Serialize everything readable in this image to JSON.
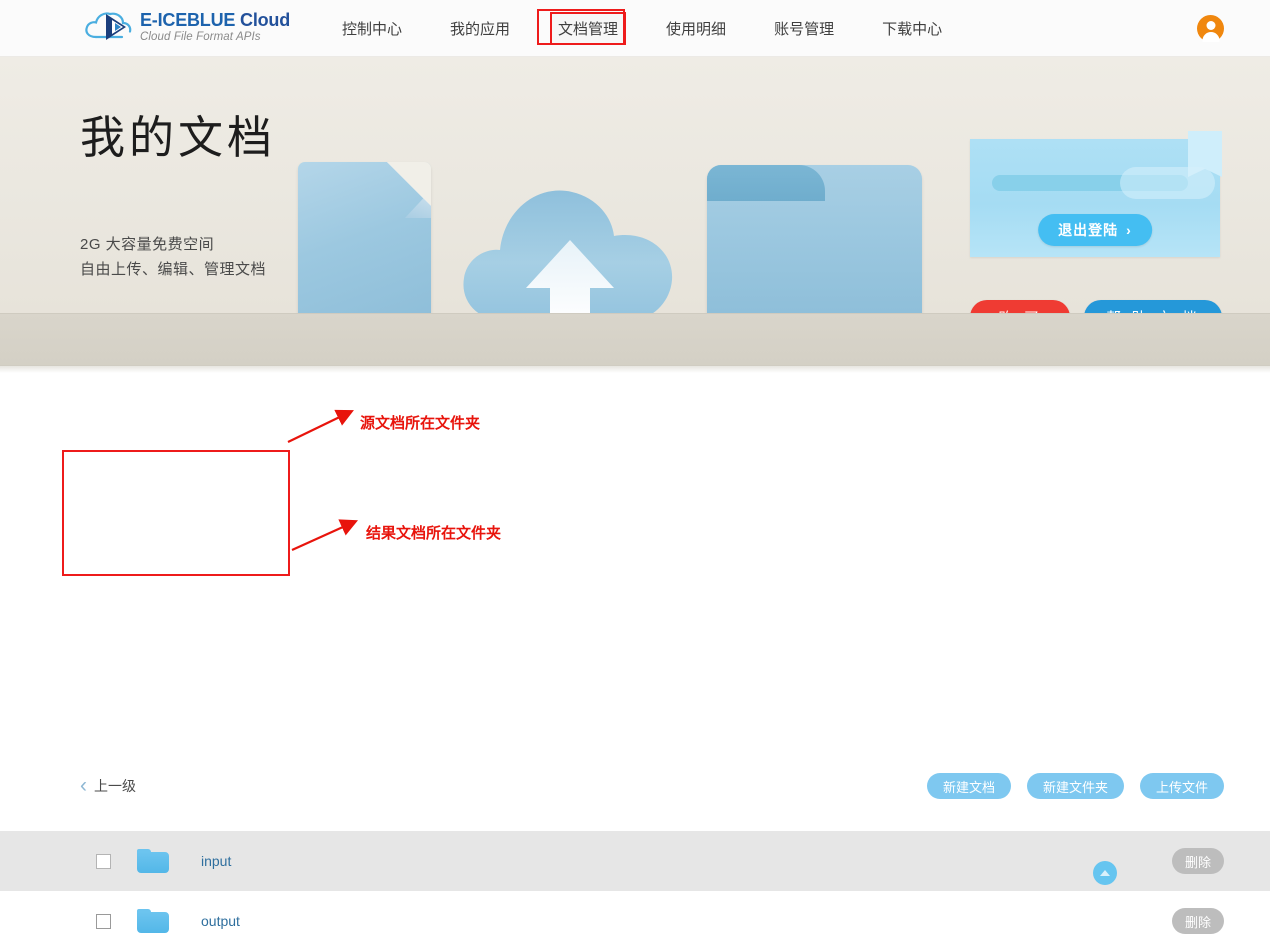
{
  "header": {
    "logo": {
      "icon": "cloud-logo-icon",
      "title_part1": "E-ICEBLUE",
      "title_part2": "Cloud",
      "subtitle": "Cloud File Format APIs"
    },
    "nav": [
      {
        "label": "控制中心",
        "name": "nav-control-center",
        "marked": false
      },
      {
        "label": "我的应用",
        "name": "nav-my-apps",
        "marked": false
      },
      {
        "label": "文档管理",
        "name": "nav-document-management",
        "marked": true
      },
      {
        "label": "使用明细",
        "name": "nav-usage-details",
        "marked": false
      },
      {
        "label": "账号管理",
        "name": "nav-account-management",
        "marked": false
      },
      {
        "label": "下载中心",
        "name": "nav-download-center",
        "marked": false
      }
    ],
    "avatar_icon": "user-avatar-icon"
  },
  "hero": {
    "title": "我的文档",
    "subtitle_line1": "2G 大容量免费空间",
    "subtitle_line2": "自由上传、编辑、管理文档",
    "graphics": [
      "document-icon",
      "cloud-upload-icon",
      "folder-icon"
    ],
    "logout_button": "退出登陆",
    "logout_chevron": "›",
    "buy_button": "购 买",
    "help_button": "帮 助 文 档"
  },
  "file_manager": {
    "up_level": {
      "chevron": "‹",
      "label": "上一级"
    },
    "actions": [
      {
        "label": "新建文档",
        "name": "new-document-button"
      },
      {
        "label": "新建文件夹",
        "name": "new-folder-button"
      },
      {
        "label": "上传文件",
        "name": "upload-file-button"
      }
    ],
    "rows": [
      {
        "name": "input",
        "checked": false,
        "delete_label": "删除",
        "highlighted": true
      },
      {
        "name": "output",
        "checked": false,
        "delete_label": "删除",
        "highlighted": false
      }
    ],
    "scroll_top_icon": "scroll-to-top-icon"
  },
  "annotations": {
    "source_folder": "源文档所在文件夹",
    "result_folder": "结果文档所在文件夹",
    "highlight_color": "#ee1b1b"
  }
}
